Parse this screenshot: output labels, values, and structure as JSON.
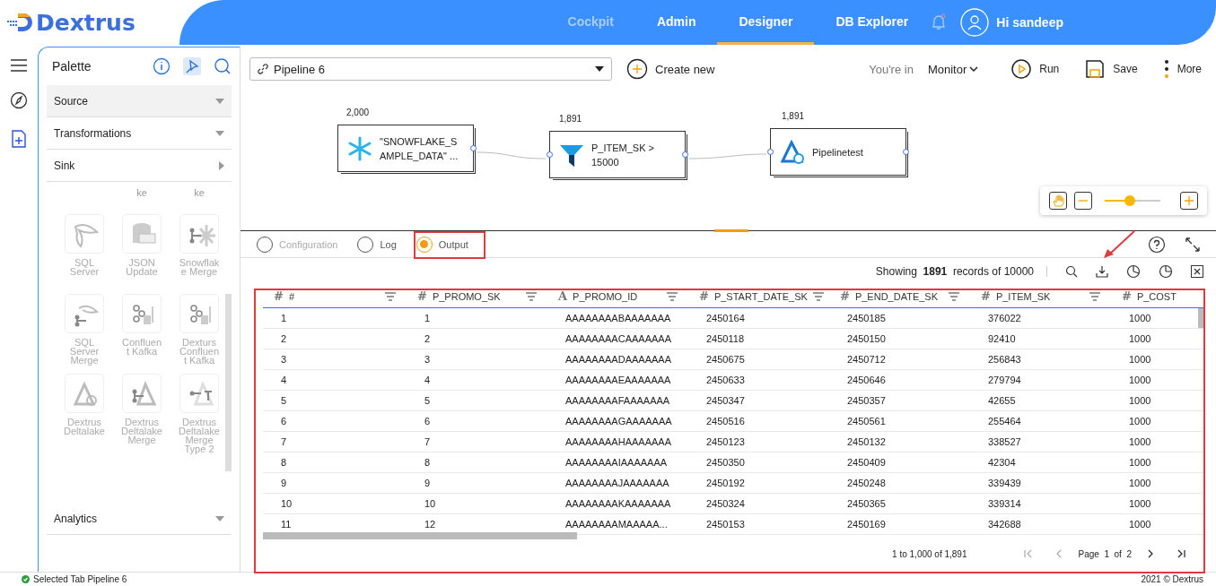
{
  "brand": "Dextrus",
  "nav": [
    {
      "label": "Cockpit",
      "selected": false,
      "disabled": true
    },
    {
      "label": "Admin",
      "selected": false,
      "disabled": false
    },
    {
      "label": "Designer",
      "selected": true,
      "disabled": false
    },
    {
      "label": "DB Explorer",
      "selected": false,
      "disabled": false
    }
  ],
  "user": "Hi sandeep",
  "palette": {
    "title": "Palette",
    "sections": [
      {
        "label": "Source",
        "expanded": true,
        "highlighted": true
      },
      {
        "label": "Transformations",
        "expanded": true,
        "highlighted": false
      },
      {
        "label": "Sink",
        "expanded": false,
        "highlighted": false
      }
    ],
    "partial_labels": [
      "ke",
      "ke"
    ],
    "components": [
      {
        "label": "SQL Server",
        "kind": "sqlserver"
      },
      {
        "label": "JSON Update",
        "kind": "jdbc"
      },
      {
        "label": "Snowflake Merge",
        "kind": "snowmerge"
      },
      {
        "label": "SQL Server Merge",
        "kind": "sqlmerge"
      },
      {
        "label": "Confluent Kafka",
        "kind": "kafka"
      },
      {
        "label": "Dexturs Confluent Kafka",
        "kind": "kafka"
      },
      {
        "label": "Dextrus Deltalake",
        "kind": "delta"
      },
      {
        "label": "Dextrus Deltalake Merge",
        "kind": "deltamerge"
      },
      {
        "label": "Dextrus Deltalake Merge Type 2",
        "kind": "deltatype2"
      }
    ],
    "footer_section": {
      "label": "Analytics",
      "expanded": true,
      "highlighted": false
    }
  },
  "toolbar": {
    "pipeline": "Pipeline 6",
    "create_new": "Create new",
    "mode_prefix": "You're in",
    "mode": "Monitor",
    "actions": [
      {
        "label": "Run",
        "kind": "run"
      },
      {
        "label": "Save",
        "kind": "save"
      },
      {
        "label": "More",
        "kind": "more"
      }
    ]
  },
  "nodes": [
    {
      "count": "2,000",
      "label": "\"SNOWFLAKE_SAMPLE_DATA\" ...",
      "kind": "snowflake"
    },
    {
      "count": "1,891",
      "label": "P_ITEM_SK > 15000",
      "kind": "filter"
    },
    {
      "count": "1,891",
      "label": "Pipelinetest",
      "kind": "delta"
    }
  ],
  "zoom": {
    "level": 0.45
  },
  "tabs": [
    {
      "label": "Configuration",
      "selected": false,
      "disabled": true
    },
    {
      "label": "Log",
      "selected": false,
      "disabled": false
    },
    {
      "label": "Output",
      "selected": true,
      "disabled": false
    }
  ],
  "showing": {
    "prefix": "Showing",
    "count": "1891",
    "suffix": "records of 10000"
  },
  "table": {
    "columns": [
      {
        "label": "#",
        "type_icon": "#"
      },
      {
        "label": "P_PROMO_SK",
        "type_icon": "#"
      },
      {
        "label": "P_PROMO_ID",
        "type_icon": "A"
      },
      {
        "label": "P_START_DATE_SK",
        "type_icon": "#"
      },
      {
        "label": "P_END_DATE_SK",
        "type_icon": "#"
      },
      {
        "label": "P_ITEM_SK",
        "type_icon": "#"
      },
      {
        "label": "P_COST",
        "type_icon": "#"
      }
    ],
    "rows": [
      [
        "1",
        "1",
        "AAAAAAAABAAAAAAA",
        "2450164",
        "2450185",
        "376022",
        "1000"
      ],
      [
        "2",
        "2",
        "AAAAAAAACAAAAAAA",
        "2450118",
        "2450150",
        "92410",
        "1000"
      ],
      [
        "3",
        "3",
        "AAAAAAAADAAAAAAA",
        "2450675",
        "2450712",
        "256843",
        "1000"
      ],
      [
        "4",
        "4",
        "AAAAAAAAEAAAAAAA",
        "2450633",
        "2450646",
        "279794",
        "1000"
      ],
      [
        "5",
        "5",
        "AAAAAAAAFAAAAAAA",
        "2450347",
        "2450357",
        "42655",
        "1000"
      ],
      [
        "6",
        "6",
        "AAAAAAAAGAAAAAAA",
        "2450516",
        "2450561",
        "255464",
        "1000"
      ],
      [
        "7",
        "7",
        "AAAAAAAAHAAAAAAA",
        "2450123",
        "2450132",
        "338527",
        "1000"
      ],
      [
        "8",
        "8",
        "AAAAAAAAIAAAAAAA",
        "2450350",
        "2450409",
        "42304",
        "1000"
      ],
      [
        "9",
        "9",
        "AAAAAAAAJAAAAAAA",
        "2450192",
        "2450248",
        "339439",
        "1000"
      ],
      [
        "10",
        "10",
        "AAAAAAAAKAAAAAAA",
        "2450324",
        "2450365",
        "339314",
        "1000"
      ],
      [
        "11",
        "12",
        "AAAAAAAAMAAAAA...",
        "2450153",
        "2450169",
        "342688",
        "1000"
      ]
    ]
  },
  "pagination": {
    "range": "1 to 1,000 of 1,891",
    "page_label": "Page",
    "page": "1",
    "of": "of",
    "pages": "2"
  },
  "status_bar": {
    "message": "Selected Tab Pipeline 6",
    "copyright": "2021 © Dextrus"
  }
}
